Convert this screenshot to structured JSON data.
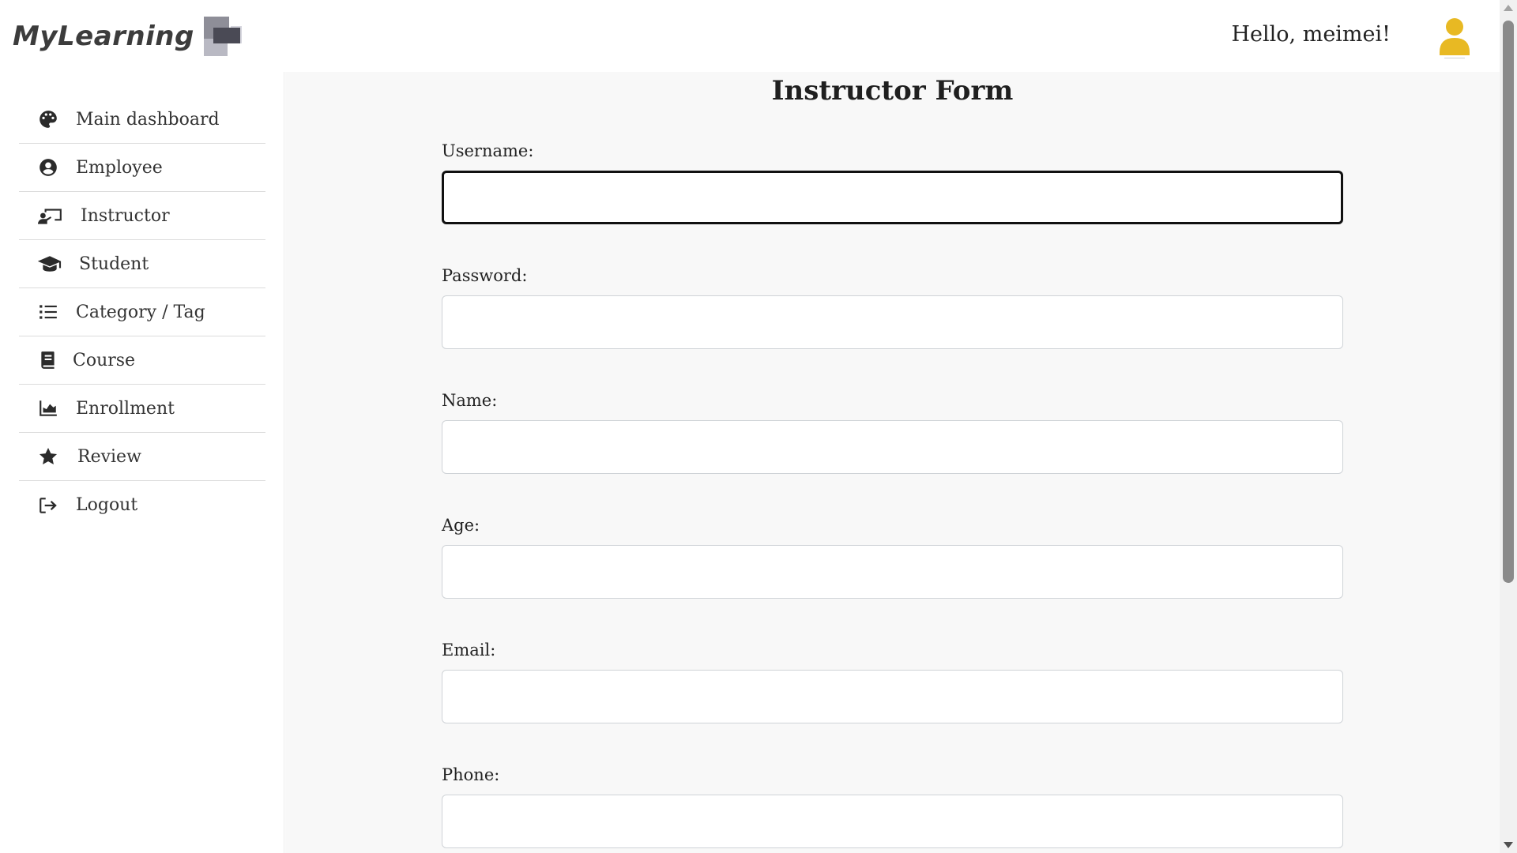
{
  "header": {
    "logo_text": "MyLearning",
    "greeting": "Hello, meimei!",
    "avatar_color": "#e8b923"
  },
  "sidebar": {
    "items": [
      {
        "label": "Main dashboard",
        "icon": "palette-icon"
      },
      {
        "label": "Employee",
        "icon": "user-circle-icon"
      },
      {
        "label": "Instructor",
        "icon": "chalkboard-teacher-icon"
      },
      {
        "label": "Student",
        "icon": "graduation-cap-icon"
      },
      {
        "label": "Category / Tag",
        "icon": "list-icon"
      },
      {
        "label": "Course",
        "icon": "book-icon"
      },
      {
        "label": "Enrollment",
        "icon": "area-chart-icon"
      },
      {
        "label": "Review",
        "icon": "star-icon"
      },
      {
        "label": "Logout",
        "icon": "sign-out-icon"
      }
    ]
  },
  "form": {
    "title": "Instructor Form",
    "fields": [
      {
        "label": "Username:",
        "value": ""
      },
      {
        "label": "Password:",
        "value": ""
      },
      {
        "label": "Name:",
        "value": ""
      },
      {
        "label": "Age:",
        "value": ""
      },
      {
        "label": "Email:",
        "value": ""
      },
      {
        "label": "Phone:",
        "value": ""
      }
    ]
  }
}
